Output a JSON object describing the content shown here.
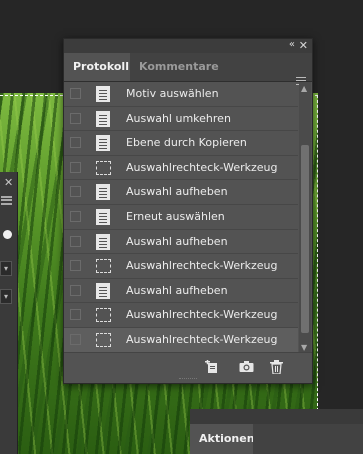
{
  "panel": {
    "collapse_glyph": "«",
    "close_glyph": "✕",
    "tabs": [
      {
        "label": "Protokoll",
        "active": true
      },
      {
        "label": "Kommentare",
        "active": false
      }
    ],
    "history": [
      {
        "icon": "document-icon",
        "label": "Motiv auswählen"
      },
      {
        "icon": "document-icon",
        "label": "Auswahl umkehren"
      },
      {
        "icon": "document-icon",
        "label": "Ebene durch Kopieren"
      },
      {
        "icon": "marquee-icon",
        "label": "Auswahlrechteck-Werkzeug"
      },
      {
        "icon": "document-icon",
        "label": "Auswahl aufheben"
      },
      {
        "icon": "document-icon",
        "label": "Erneut auswählen"
      },
      {
        "icon": "document-icon",
        "label": "Auswahl aufheben"
      },
      {
        "icon": "marquee-icon",
        "label": "Auswahlrechteck-Werkzeug"
      },
      {
        "icon": "document-icon",
        "label": "Auswahl aufheben"
      },
      {
        "icon": "marquee-icon",
        "label": "Auswahlrechteck-Werkzeug"
      },
      {
        "icon": "marquee-icon",
        "label": "Auswahlrechteck-Werkzeug",
        "current": true
      }
    ],
    "footer_icons": [
      "new-document-from-state-icon",
      "camera-icon",
      "trash-icon"
    ]
  },
  "left_panel": {
    "close_glyph": "✕"
  },
  "aktionen": {
    "tab_label": "Aktionen"
  },
  "colors": {
    "panel_bg": "#535353",
    "canvas_bg": "#262626",
    "text": "#ececec"
  }
}
